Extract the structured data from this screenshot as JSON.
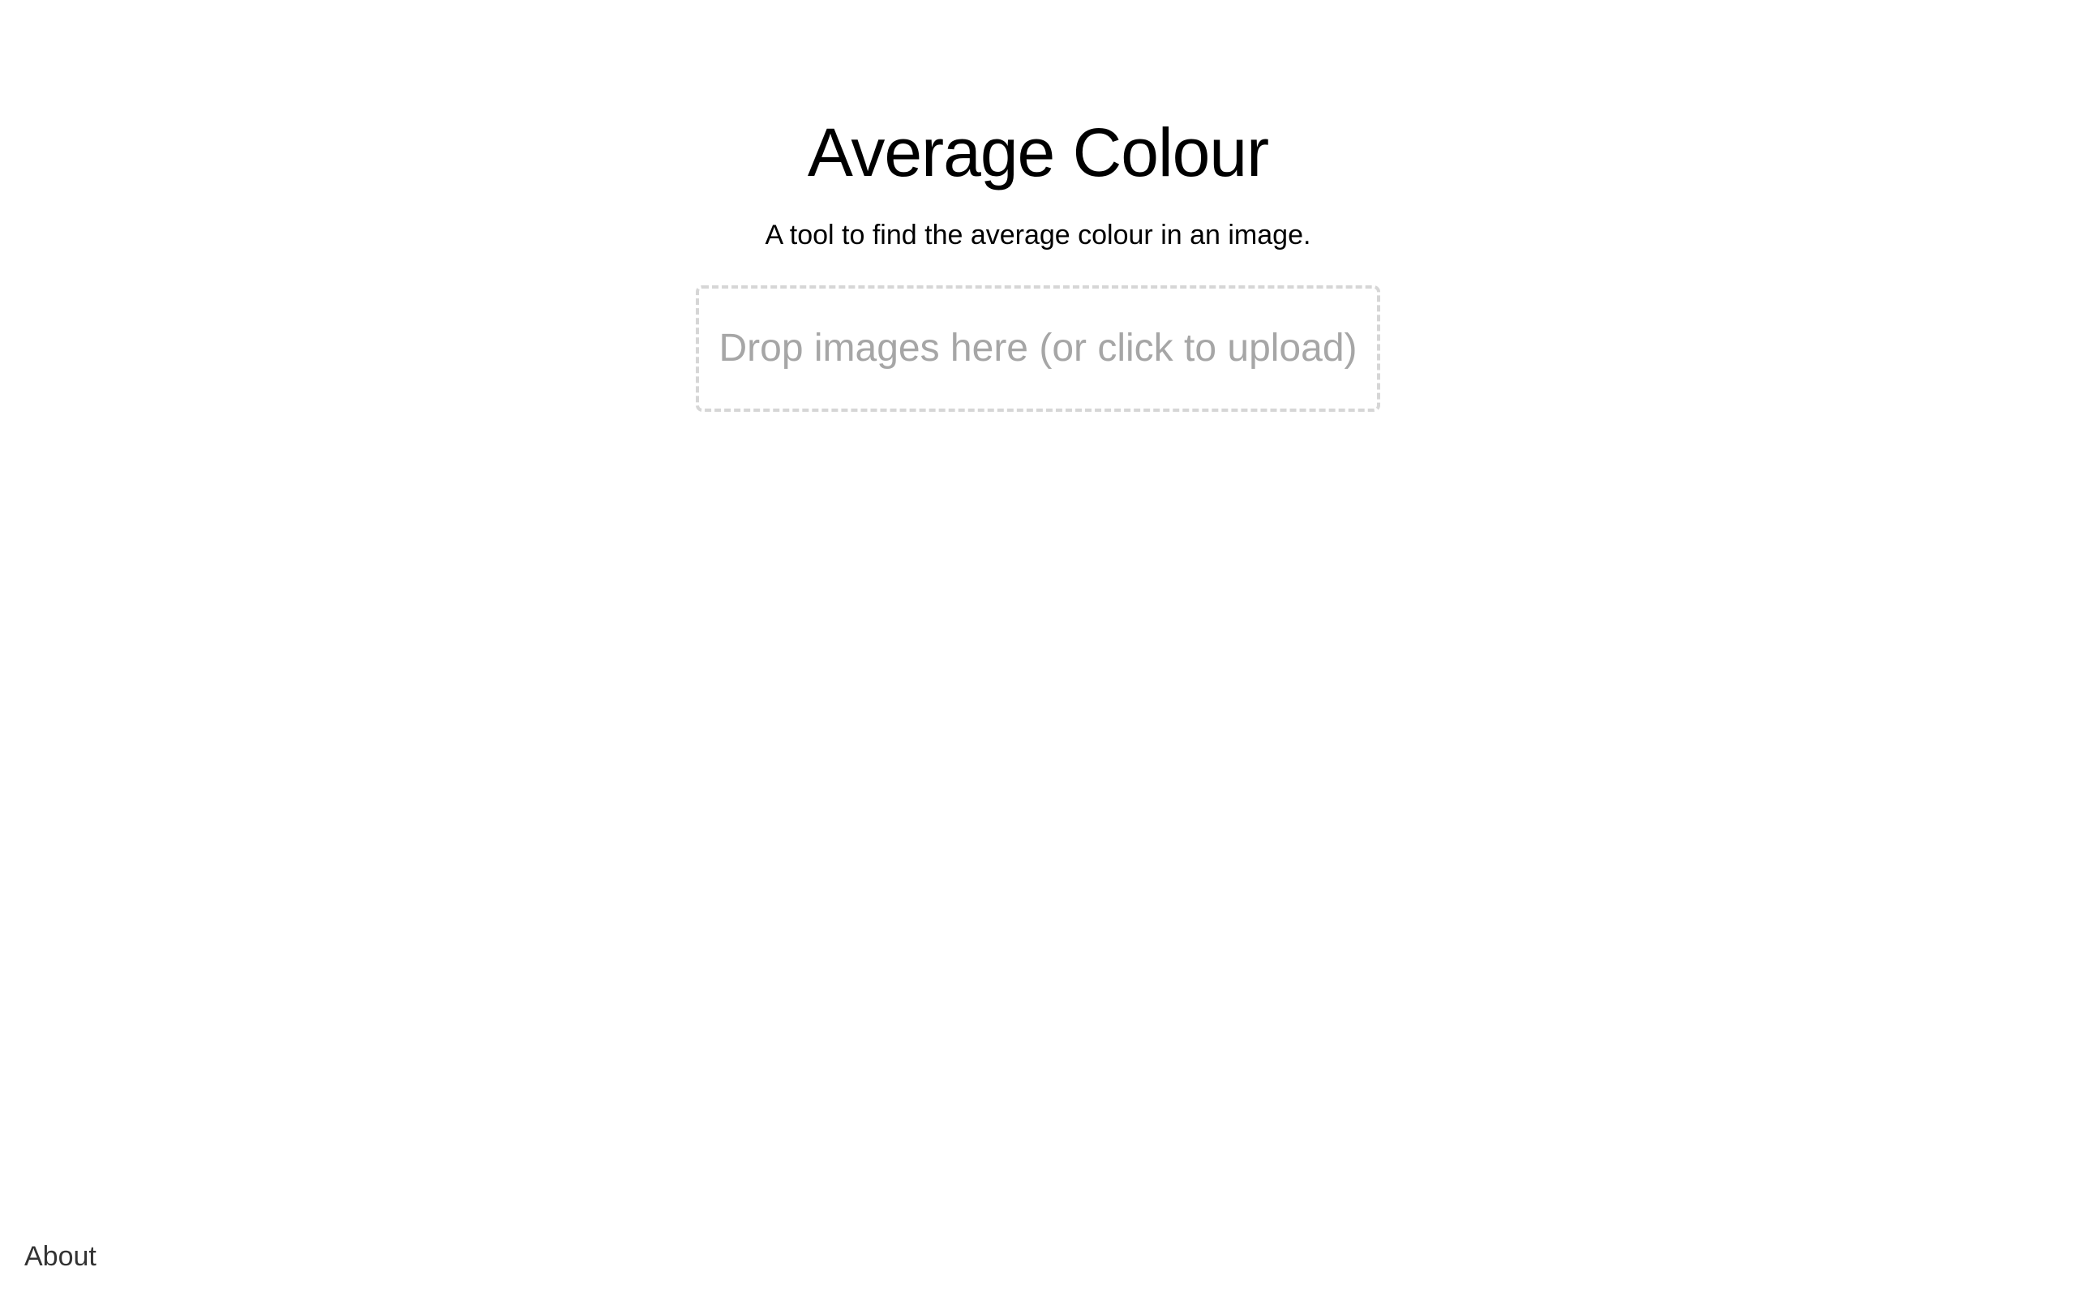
{
  "header": {
    "title": "Average Colour",
    "subtitle": "A tool to find the average colour in an image."
  },
  "dropzone": {
    "label": "Drop images here (or click to upload)"
  },
  "footer": {
    "about_link": "About"
  },
  "colors": {
    "background": "#ffffff",
    "text": "#000000",
    "dropzone_border": "#d6d6d6",
    "dropzone_text": "#a6a6a6",
    "footer_link": "#333333"
  }
}
